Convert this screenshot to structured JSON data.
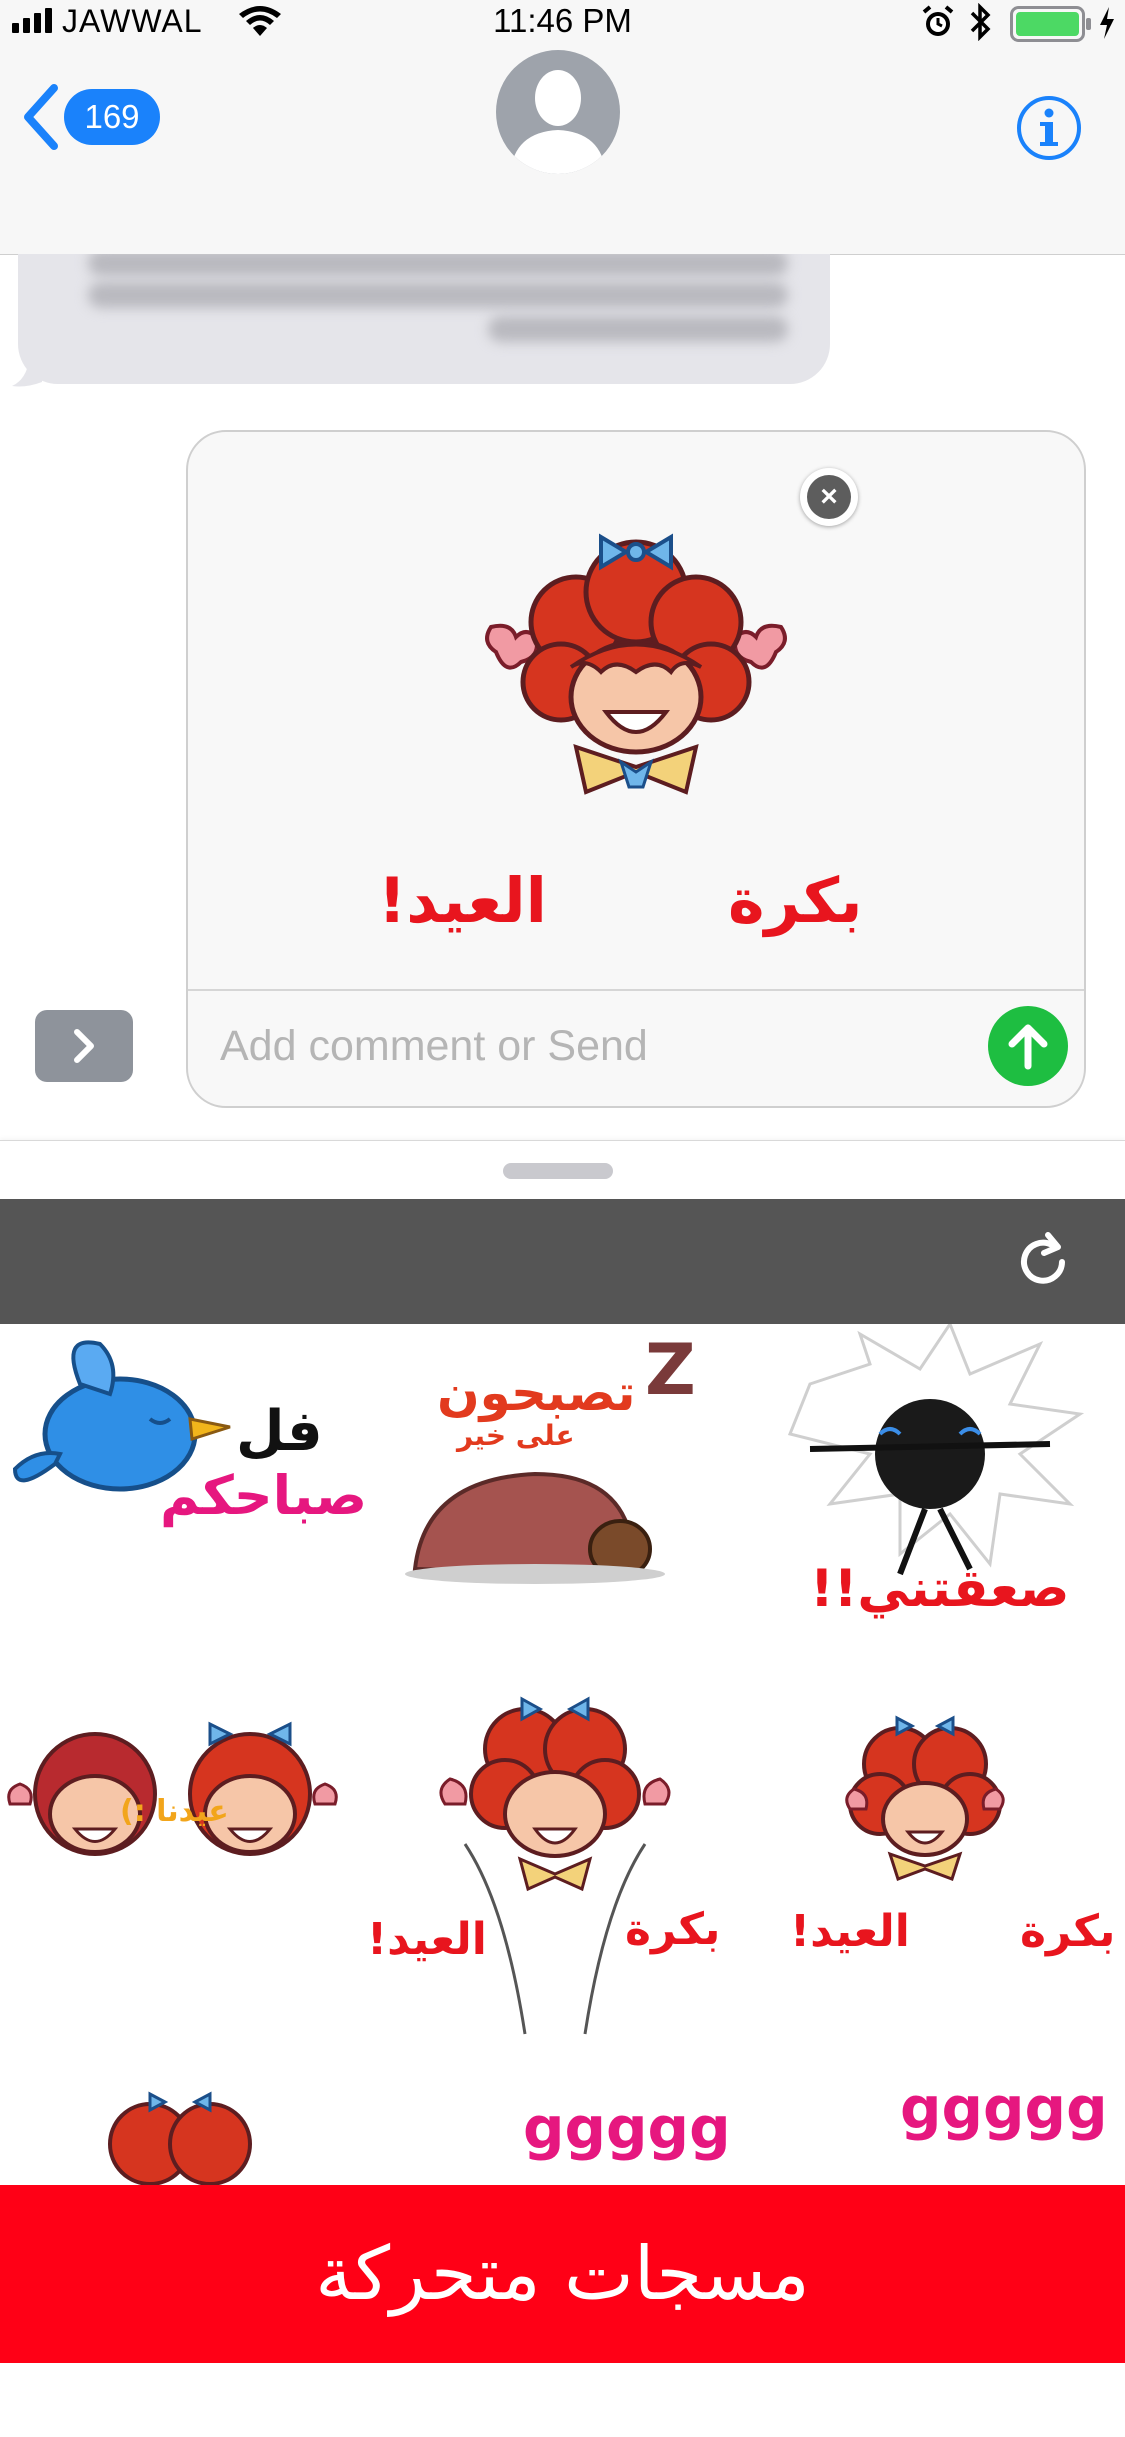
{
  "status_bar": {
    "carrier": "JAWWAL",
    "time": "11:46 PM",
    "battery_color": "#4cd964"
  },
  "nav": {
    "back_count": "169",
    "accent": "#1a82fb"
  },
  "compose": {
    "sticker_caption_right": "بكرة",
    "sticker_caption_left": "العيد!",
    "comment_placeholder": "Add comment or Send",
    "send_color": "#1ebe41"
  },
  "stickers": [
    {
      "id": "s1",
      "text_main": "فل",
      "text_sub": "صباحكم"
    },
    {
      "id": "s2",
      "text_main": "تصبحون",
      "text_sub": "على خير"
    },
    {
      "id": "s3",
      "text_main": "صعقتني!!"
    },
    {
      "id": "s4",
      "text_main": "عيدنا :)"
    },
    {
      "id": "s5",
      "text_right": "بكرة",
      "text_left": "العيد!"
    },
    {
      "id": "s6",
      "text_right": "بكرة",
      "text_left": "العيد!"
    },
    {
      "id": "s7"
    },
    {
      "id": "s8",
      "text_main": "ggggg"
    },
    {
      "id": "s9",
      "text_main": "ggggg"
    }
  ],
  "banner": {
    "text": "مسجات متحركة",
    "color": "#ff0016"
  }
}
